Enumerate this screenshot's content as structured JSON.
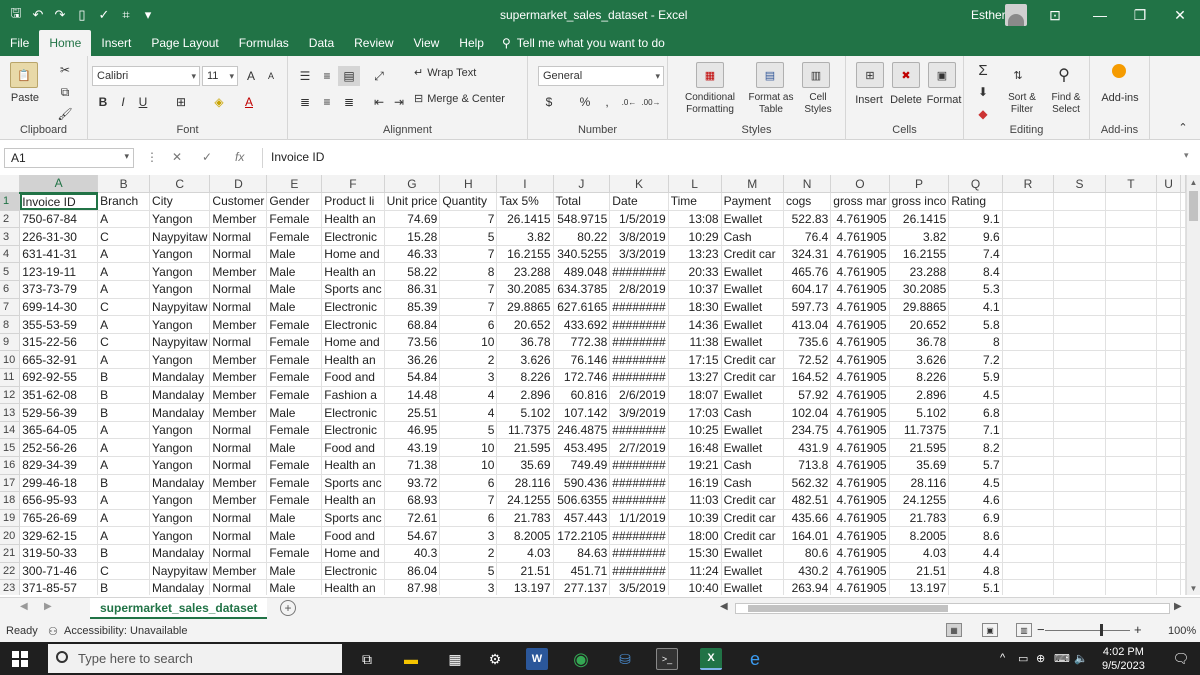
{
  "window": {
    "title": "supermarket_sales_dataset  -  Excel",
    "user": "Esther"
  },
  "tabs": [
    "File",
    "Home",
    "Insert",
    "Page Layout",
    "Formulas",
    "Data",
    "Review",
    "View",
    "Help"
  ],
  "tell_me": "Tell me what you want to do",
  "ribbon": {
    "clipboard": {
      "label": "Clipboard",
      "paste": "Paste"
    },
    "font": {
      "label": "Font",
      "name": "Calibri",
      "size": "11",
      "bold": "B",
      "italic": "I",
      "underline": "U",
      "grow": "A",
      "shrink": "A",
      "color": "A"
    },
    "alignment": {
      "label": "Alignment",
      "wrap": "Wrap Text",
      "merge": "Merge & Center"
    },
    "number": {
      "label": "Number",
      "format": "General",
      "currency": "$",
      "percent": "%",
      "comma": ","
    },
    "styles": {
      "label": "Styles",
      "conditional": "Conditional Formatting",
      "format_table": "Format as Table",
      "cell_styles": "Cell Styles"
    },
    "cells": {
      "label": "Cells",
      "insert": "Insert",
      "delete": "Delete",
      "format": "Format"
    },
    "editing": {
      "label": "Editing",
      "sort": "Sort & Filter",
      "find": "Find & Select"
    },
    "addins": {
      "label": "Add-ins",
      "btn": "Add-ins"
    }
  },
  "formula_bar": {
    "name_box": "A1",
    "fx": "fx",
    "content": "Invoice ID"
  },
  "columns": [
    "A",
    "B",
    "C",
    "D",
    "E",
    "F",
    "G",
    "H",
    "I",
    "J",
    "K",
    "L",
    "M",
    "N",
    "O",
    "P",
    "Q",
    "R",
    "S",
    "T",
    "U"
  ],
  "header_row": [
    "Invoice ID",
    "Branch",
    "City",
    "Customer",
    "Gender",
    "Product li",
    "Unit price",
    "Quantity",
    "Tax 5%",
    "Total",
    "Date",
    "Time",
    "Payment",
    "cogs",
    "gross mar",
    "gross inco",
    "Rating",
    "",
    "",
    "",
    ""
  ],
  "rows": [
    [
      "750-67-84",
      "A",
      "Yangon",
      "Member",
      "Female",
      "Health an",
      "74.69",
      "7",
      "26.1415",
      "548.9715",
      "1/5/2019",
      "13:08",
      "Ewallet",
      "522.83",
      "4.761905",
      "26.1415",
      "9.1"
    ],
    [
      "226-31-30",
      "C",
      "Naypyitaw",
      "Normal",
      "Female",
      "Electronic",
      "15.28",
      "5",
      "3.82",
      "80.22",
      "3/8/2019",
      "10:29",
      "Cash",
      "76.4",
      "4.761905",
      "3.82",
      "9.6"
    ],
    [
      "631-41-31",
      "A",
      "Yangon",
      "Normal",
      "Male",
      "Home and",
      "46.33",
      "7",
      "16.2155",
      "340.5255",
      "3/3/2019",
      "13:23",
      "Credit car",
      "324.31",
      "4.761905",
      "16.2155",
      "7.4"
    ],
    [
      "123-19-11",
      "A",
      "Yangon",
      "Member",
      "Male",
      "Health an",
      "58.22",
      "8",
      "23.288",
      "489.048",
      "########",
      "20:33",
      "Ewallet",
      "465.76",
      "4.761905",
      "23.288",
      "8.4"
    ],
    [
      "373-73-79",
      "A",
      "Yangon",
      "Normal",
      "Male",
      "Sports anc",
      "86.31",
      "7",
      "30.2085",
      "634.3785",
      "2/8/2019",
      "10:37",
      "Ewallet",
      "604.17",
      "4.761905",
      "30.2085",
      "5.3"
    ],
    [
      "699-14-30",
      "C",
      "Naypyitaw",
      "Normal",
      "Male",
      "Electronic",
      "85.39",
      "7",
      "29.8865",
      "627.6165",
      "########",
      "18:30",
      "Ewallet",
      "597.73",
      "4.761905",
      "29.8865",
      "4.1"
    ],
    [
      "355-53-59",
      "A",
      "Yangon",
      "Member",
      "Female",
      "Electronic",
      "68.84",
      "6",
      "20.652",
      "433.692",
      "########",
      "14:36",
      "Ewallet",
      "413.04",
      "4.761905",
      "20.652",
      "5.8"
    ],
    [
      "315-22-56",
      "C",
      "Naypyitaw",
      "Normal",
      "Female",
      "Home and",
      "73.56",
      "10",
      "36.78",
      "772.38",
      "########",
      "11:38",
      "Ewallet",
      "735.6",
      "4.761905",
      "36.78",
      "8"
    ],
    [
      "665-32-91",
      "A",
      "Yangon",
      "Member",
      "Female",
      "Health an",
      "36.26",
      "2",
      "3.626",
      "76.146",
      "########",
      "17:15",
      "Credit car",
      "72.52",
      "4.761905",
      "3.626",
      "7.2"
    ],
    [
      "692-92-55",
      "B",
      "Mandalay",
      "Member",
      "Female",
      "Food and",
      "54.84",
      "3",
      "8.226",
      "172.746",
      "########",
      "13:27",
      "Credit car",
      "164.52",
      "4.761905",
      "8.226",
      "5.9"
    ],
    [
      "351-62-08",
      "B",
      "Mandalay",
      "Member",
      "Female",
      "Fashion a",
      "14.48",
      "4",
      "2.896",
      "60.816",
      "2/6/2019",
      "18:07",
      "Ewallet",
      "57.92",
      "4.761905",
      "2.896",
      "4.5"
    ],
    [
      "529-56-39",
      "B",
      "Mandalay",
      "Member",
      "Male",
      "Electronic",
      "25.51",
      "4",
      "5.102",
      "107.142",
      "3/9/2019",
      "17:03",
      "Cash",
      "102.04",
      "4.761905",
      "5.102",
      "6.8"
    ],
    [
      "365-64-05",
      "A",
      "Yangon",
      "Normal",
      "Female",
      "Electronic",
      "46.95",
      "5",
      "11.7375",
      "246.4875",
      "########",
      "10:25",
      "Ewallet",
      "234.75",
      "4.761905",
      "11.7375",
      "7.1"
    ],
    [
      "252-56-26",
      "A",
      "Yangon",
      "Normal",
      "Male",
      "Food and",
      "43.19",
      "10",
      "21.595",
      "453.495",
      "2/7/2019",
      "16:48",
      "Ewallet",
      "431.9",
      "4.761905",
      "21.595",
      "8.2"
    ],
    [
      "829-34-39",
      "A",
      "Yangon",
      "Normal",
      "Female",
      "Health an",
      "71.38",
      "10",
      "35.69",
      "749.49",
      "########",
      "19:21",
      "Cash",
      "713.8",
      "4.761905",
      "35.69",
      "5.7"
    ],
    [
      "299-46-18",
      "B",
      "Mandalay",
      "Member",
      "Female",
      "Sports anc",
      "93.72",
      "6",
      "28.116",
      "590.436",
      "########",
      "16:19",
      "Cash",
      "562.32",
      "4.761905",
      "28.116",
      "4.5"
    ],
    [
      "656-95-93",
      "A",
      "Yangon",
      "Member",
      "Female",
      "Health an",
      "68.93",
      "7",
      "24.1255",
      "506.6355",
      "########",
      "11:03",
      "Credit car",
      "482.51",
      "4.761905",
      "24.1255",
      "4.6"
    ],
    [
      "765-26-69",
      "A",
      "Yangon",
      "Normal",
      "Male",
      "Sports anc",
      "72.61",
      "6",
      "21.783",
      "457.443",
      "1/1/2019",
      "10:39",
      "Credit car",
      "435.66",
      "4.761905",
      "21.783",
      "6.9"
    ],
    [
      "329-62-15",
      "A",
      "Yangon",
      "Normal",
      "Male",
      "Food and",
      "54.67",
      "3",
      "8.2005",
      "172.2105",
      "########",
      "18:00",
      "Credit car",
      "164.01",
      "4.761905",
      "8.2005",
      "8.6"
    ],
    [
      "319-50-33",
      "B",
      "Mandalay",
      "Normal",
      "Female",
      "Home and",
      "40.3",
      "2",
      "4.03",
      "84.63",
      "########",
      "15:30",
      "Ewallet",
      "80.6",
      "4.761905",
      "4.03",
      "4.4"
    ],
    [
      "300-71-46",
      "C",
      "Naypyitaw",
      "Member",
      "Male",
      "Electronic",
      "86.04",
      "5",
      "21.51",
      "451.71",
      "########",
      "11:24",
      "Ewallet",
      "430.2",
      "4.761905",
      "21.51",
      "4.8"
    ],
    [
      "371-85-57",
      "B",
      "Mandalay",
      "Normal",
      "Male",
      "Health an",
      "87.98",
      "3",
      "13.197",
      "277.137",
      "3/5/2019",
      "10:40",
      "Ewallet",
      "263.94",
      "4.761905",
      "13.197",
      "5.1"
    ]
  ],
  "sheet_tab": "supermarket_sales_dataset",
  "status": {
    "ready": "Ready",
    "accessibility": "Accessibility: Unavailable",
    "zoom": "100%"
  },
  "taskbar": {
    "search_placeholder": "Type here to search",
    "time": "4:02 PM",
    "date": "9/5/2023"
  }
}
